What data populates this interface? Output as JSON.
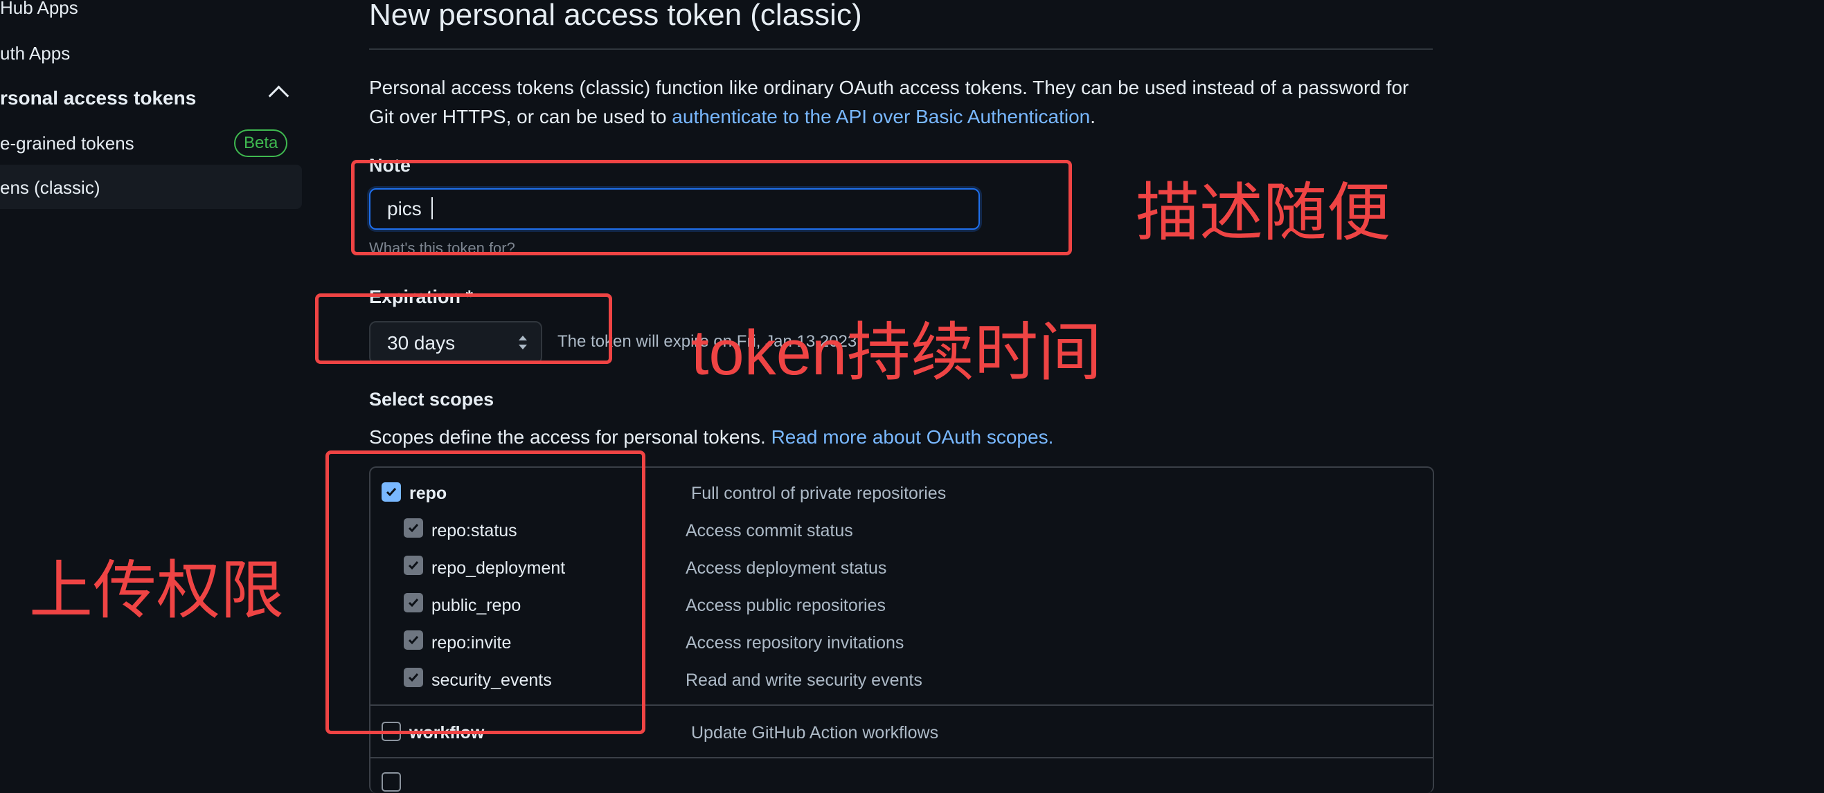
{
  "sidebar": {
    "items": [
      {
        "label": "Hub Apps"
      },
      {
        "label": "uth Apps"
      },
      {
        "label": "rsonal access tokens"
      },
      {
        "label": "e-grained tokens",
        "badge": "Beta"
      },
      {
        "label": "ens (classic)"
      }
    ]
  },
  "main": {
    "title": "New personal access token (classic)",
    "description_text": "Personal access tokens (classic) function like ordinary OAuth access tokens. They can be used instead of a password for Git over HTTPS, or can be used to ",
    "description_link": "authenticate to the API over Basic Authentication",
    "description_end": ".",
    "note": {
      "label": "Note",
      "value": "pics",
      "hint": "What's this token for?"
    },
    "expiration": {
      "label": "Expiration *",
      "value": "30 days",
      "note": "The token will expire on Fri, Jan 13 2023"
    },
    "scopes": {
      "title": "Select scopes",
      "desc_text": "Scopes define the access for personal tokens. ",
      "desc_link": "Read more about OAuth scopes.",
      "items": [
        {
          "name": "repo",
          "desc": "Full control of private repositories",
          "checked": true
        },
        {
          "name": "repo:status",
          "desc": "Access commit status",
          "checked": true
        },
        {
          "name": "repo_deployment",
          "desc": "Access deployment status",
          "checked": true
        },
        {
          "name": "public_repo",
          "desc": "Access public repositories",
          "checked": true
        },
        {
          "name": "repo:invite",
          "desc": "Access repository invitations",
          "checked": true
        },
        {
          "name": "security_events",
          "desc": "Read and write security events",
          "checked": true
        },
        {
          "name": "workflow",
          "desc": "Update GitHub Action workflows",
          "checked": false
        }
      ]
    }
  },
  "annotations": {
    "note_label": "描述随便",
    "expiration_label": "token持续时间",
    "scopes_label": "上传权限",
    "color": "#ef4444"
  },
  "colors": {
    "background": "#0d1117",
    "link": "#79b8ff",
    "badge": "#3fb950",
    "focus": "#1f6feb"
  }
}
